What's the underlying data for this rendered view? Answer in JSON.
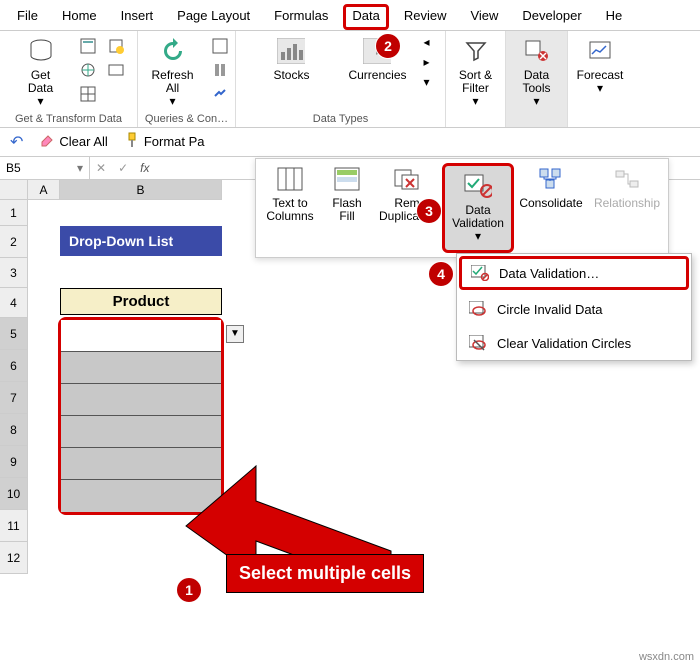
{
  "tabs": {
    "file": "File",
    "home": "Home",
    "insert": "Insert",
    "page_layout": "Page Layout",
    "formulas": "Formulas",
    "data": "Data",
    "review": "Review",
    "view": "View",
    "developer": "Developer",
    "help": "He"
  },
  "ribbon": {
    "get_data": "Get\nData",
    "refresh_all": "Refresh\nAll",
    "group_get": "Get & Transform Data",
    "group_queries": "Queries & Con…",
    "stocks": "Stocks",
    "currencies": "Currencies",
    "group_types": "Data Types",
    "sort_filter": "Sort &\nFilter",
    "data_tools": "Data\nTools",
    "forecast": "Forecast"
  },
  "toolbar2": {
    "clear_all": "Clear All",
    "format_pa": "Format Pa"
  },
  "secondary": {
    "text_to_columns": "Text to\nColumns",
    "flash_fill": "Flash\nFill",
    "remove_duplicates": "Rem\nDuplicates",
    "data_validation": "Data\nValidation",
    "consolidate": "Consolidate",
    "relationships": "Relationship"
  },
  "menu": {
    "data_validation": "Data Validation…",
    "circle_invalid": "Circle Invalid Data",
    "clear_circles": "Clear Validation Circles"
  },
  "namebox": "B5",
  "columns": [
    "A",
    "B"
  ],
  "rows": [
    "1",
    "2",
    "3",
    "4",
    "5",
    "6",
    "7",
    "8",
    "9",
    "10",
    "11",
    "12"
  ],
  "heading": "Drop-Down List",
  "product_header": "Product",
  "callout": "Select multiple cells",
  "steps": {
    "s1": "1",
    "s2": "2",
    "s3": "3",
    "s4": "4"
  },
  "watermark": "wsxdn.com"
}
